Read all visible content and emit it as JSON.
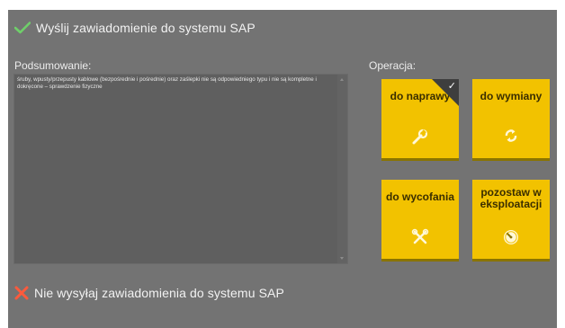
{
  "options": {
    "send_label": "Wyślij zawiadomienie do systemu SAP",
    "nosend_label": "Nie wysyłaj zawiadomienia do systemu SAP"
  },
  "summary": {
    "label": "Podsumowanie:",
    "text": "śruby, wpusty/przepusty kablowe (bezpośrednie i pośrednie) oraz zaślepki nie są odpowiedniego typu i nie są kompletne i dokręcone – sprawdzenie fizyczne"
  },
  "operation": {
    "label": "Operacja:",
    "tiles": [
      {
        "label": "do naprawy",
        "icon": "wrench-icon",
        "selected": true
      },
      {
        "label": "do wymiany",
        "icon": "swap-icon",
        "selected": false
      },
      {
        "label": "do wycofania",
        "icon": "tools-cross-icon",
        "selected": false
      },
      {
        "label": "pozostaw w eksploatacji",
        "icon": "gauge-icon",
        "selected": false
      }
    ]
  },
  "colors": {
    "panel": "#737373",
    "tile": "#f2c200",
    "accept": "#6fcf6a",
    "reject": "#ff5a3c"
  }
}
